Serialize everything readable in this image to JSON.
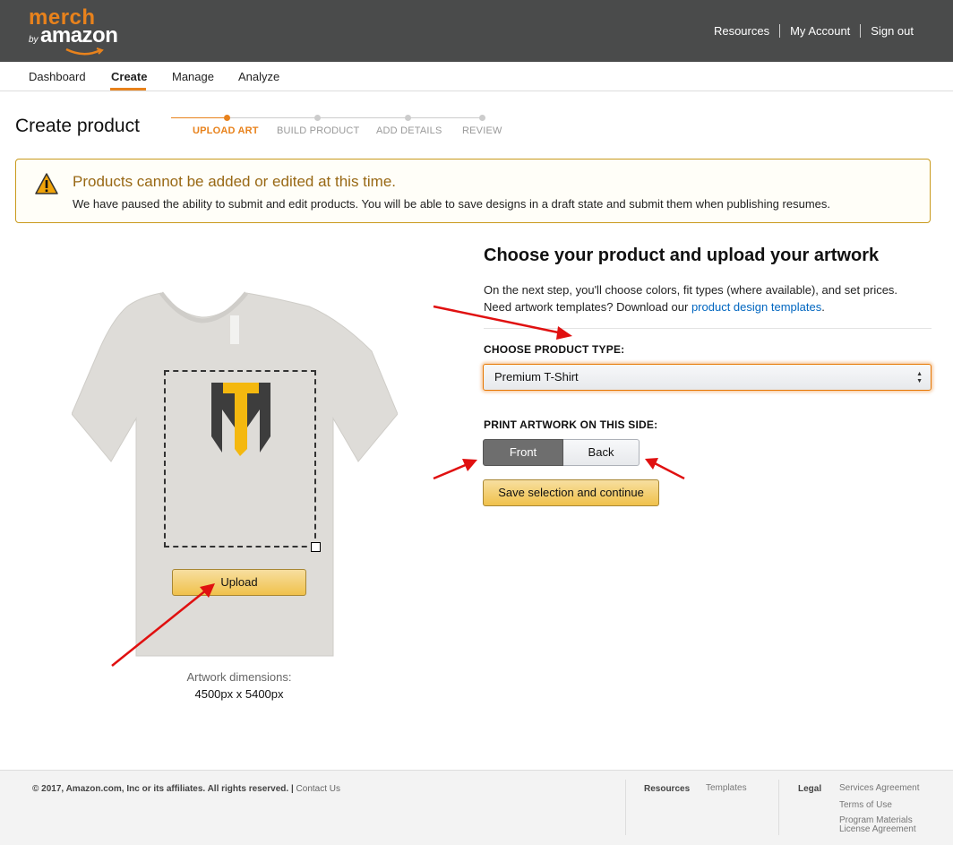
{
  "header": {
    "logo_merch": "merch",
    "logo_by": "by",
    "logo_amazon": "amazon",
    "links": [
      "Resources",
      "My Account",
      "Sign out"
    ]
  },
  "nav": {
    "tabs": [
      "Dashboard",
      "Create",
      "Manage",
      "Analyze"
    ],
    "active": "Create"
  },
  "page": {
    "title": "Create product",
    "steps": [
      "UPLOAD ART",
      "BUILD PRODUCT",
      "ADD DETAILS",
      "REVIEW"
    ],
    "active_step": "UPLOAD ART"
  },
  "alert": {
    "title": "Products cannot be added or edited at this time.",
    "message": "We have paused the ability to submit and edit products. You will be able to save designs in a draft state and submit them when publishing resumes.",
    "icon": "warning-triangle-icon"
  },
  "preview": {
    "upload_label": "Upload",
    "dimensions_label": "Artwork dimensions:",
    "dimensions_value": "4500px x 5400px"
  },
  "form": {
    "heading": "Choose your product and upload your artwork",
    "desc_line1": "On the next step, you'll choose colors, fit types (where available), and set prices.",
    "desc_line2_prefix": "Need artwork templates? Download our ",
    "desc_link": "product design templates",
    "desc_line2_suffix": ".",
    "product_type_label": "CHOOSE PRODUCT TYPE:",
    "product_type_value": "Premium T-Shirt",
    "print_side_label": "PRINT ARTWORK ON THIS SIDE:",
    "side_front": "Front",
    "side_back": "Back",
    "selected_side": "Front",
    "save_label": "Save selection and continue"
  },
  "footer": {
    "copyright": "© 2017, Amazon.com, Inc or its affiliates. All rights reserved. | ",
    "contact": "Contact Us",
    "resources_heading": "Resources",
    "templates": "Templates",
    "legal_heading": "Legal",
    "services_agreement": "Services Agreement",
    "terms": "Terms of Use",
    "program_materials_1": "Program Materials",
    "program_materials_2": "License Agreement"
  },
  "colors": {
    "accent": "#e8821c",
    "header_bg": "#4a4b4b",
    "button_yellow": "#f0c14b",
    "alert_border": "#c99a1d",
    "link": "#0066c0",
    "annotation_arrow": "#e01010"
  }
}
